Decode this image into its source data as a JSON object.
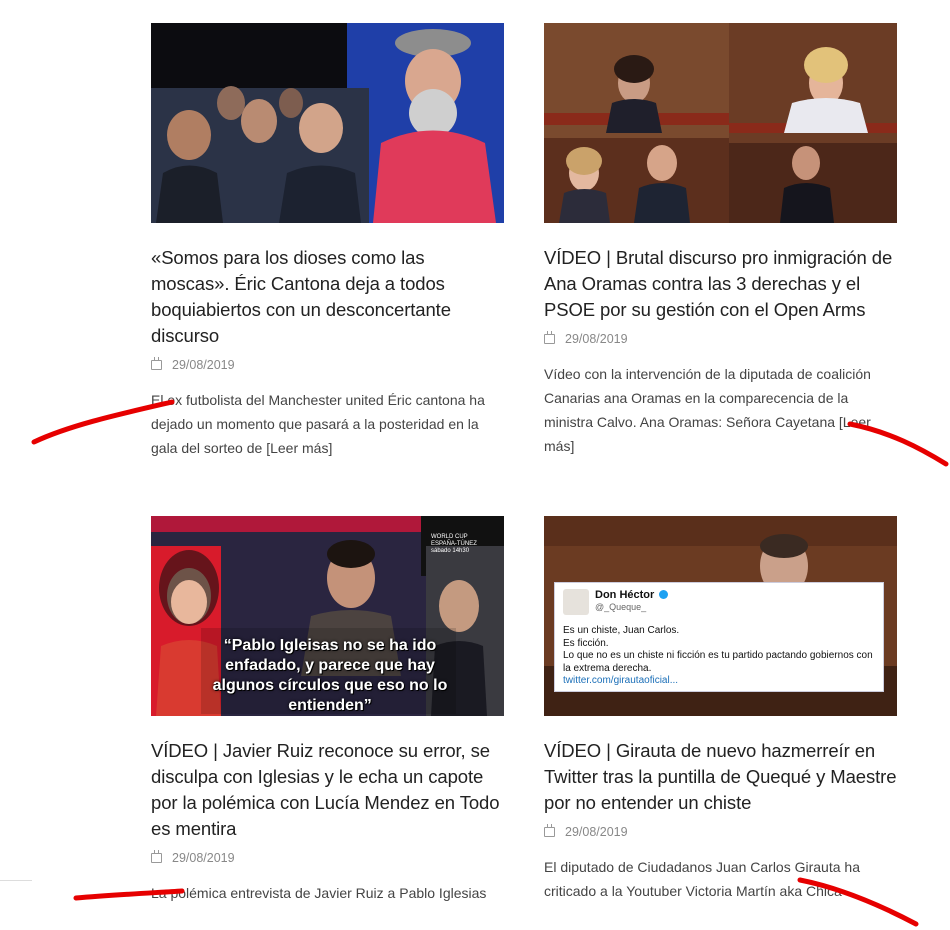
{
  "posts": [
    {
      "title": "«Somos para los dioses como las moscas». Éric Cantona deja a todos boquiabiertos con un desconcertante discurso",
      "date": "29/08/2019",
      "excerpt": "El ex futbolista del Manchester united Éric cantona ha dejado un momento que pasará a la posteridad en la gala del sorteo de",
      "read_more": "[Leer más]"
    },
    {
      "title": "VÍDEO | Brutal discurso pro inmigración de Ana Oramas contra las 3 derechas y el PSOE por su gestión con el Open Arms",
      "date": "29/08/2019",
      "excerpt": "Vídeo con la intervención de la diputada de coalición  Canarias ana Oramas en la comparecencia de la ministra Calvo. Ana Oramas: Señora Cayetana",
      "read_more": "[Leer más]"
    },
    {
      "title": "VÍDEO | Javier Ruiz reconoce su error, se disculpa con Iglesias y le echa un capote por la polémica con Lucía Mendez en Todo es mentira",
      "date": "29/08/2019",
      "excerpt": "La polémica entrevista de Javier Ruiz a Pablo Iglesias",
      "read_more": "",
      "image_caption": "“Pablo Igleisas no se ha ido enfadado, y parece que hay algunos círculos que eso no lo entienden”",
      "image_badge_top": "WORLD CUP",
      "image_badge_mid": "ESPAÑA-TÚNEZ",
      "image_badge_bot": "sábado 14h30"
    },
    {
      "title": "VÍDEO | Girauta de nuevo hazmerreír en Twitter tras la puntilla de Quequé y Maestre por no entender un chiste",
      "date": "29/08/2019",
      "excerpt": "El diputado de Ciudadanos Juan Carlos Girauta ha criticado a la Youtuber Victoria Martín aka Chica",
      "read_more": "",
      "tweet_name": "Don Héctor",
      "tweet_handle": "@_Queque_",
      "tweet_line1": "Es un chiste, Juan Carlos.",
      "tweet_line2": "Es ficción.",
      "tweet_line3": "Lo que no es un chiste ni ficción es tu partido pactando gobiernos con la extrema derecha.",
      "tweet_link": "twitter.com/girautaoficial..."
    }
  ],
  "colors": {
    "ink": "#e60000",
    "text": "#444444",
    "title": "#222222",
    "meta": "#888888"
  }
}
